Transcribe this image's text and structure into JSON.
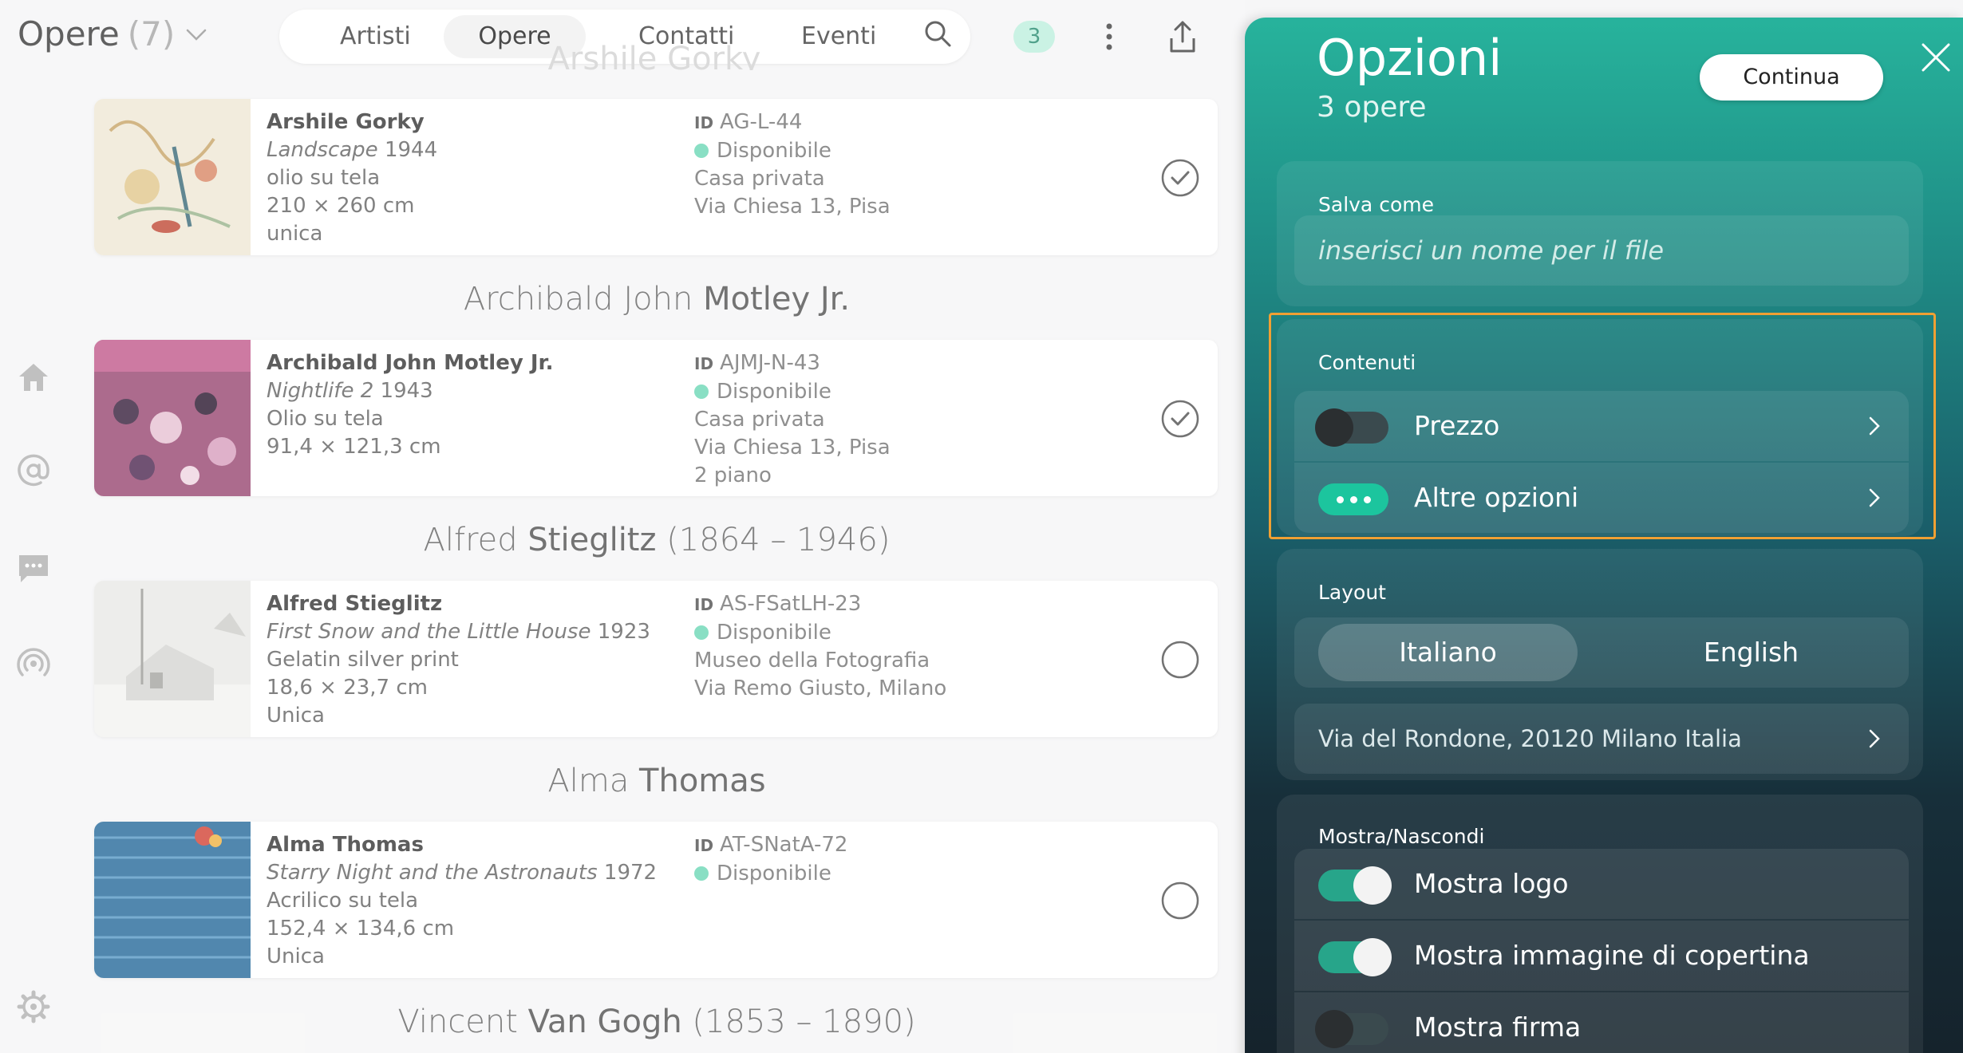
{
  "header": {
    "title": "Opere",
    "count": "(7)",
    "tabs": [
      "Artisti",
      "Opere",
      "Contatti",
      "Eventi"
    ],
    "active_tab": "Opere",
    "selected_badge": "3"
  },
  "ghost_heading": "Arshile Gorky",
  "artworks": [
    {
      "heading_pre": "",
      "heading_bold": "",
      "heading_post": "",
      "artist": "Arshile Gorky",
      "title": "Landscape",
      "year": "1944",
      "medium": "olio su tela",
      "size": "210 × 260 cm",
      "edition": "unica",
      "id": "AG-L-44",
      "status": "Disponibile",
      "location": "Casa privata",
      "address": "Via Chiesa 13, Pisa",
      "extra": "",
      "selected": true
    },
    {
      "heading_pre": "Archibald John ",
      "heading_bold": "Motley Jr.",
      "heading_post": "",
      "artist": "Archibald John Motley Jr.",
      "title": "Nightlife 2",
      "year": "1943",
      "medium": "Olio su tela",
      "size": "91,4 × 121,3 cm",
      "edition": "",
      "id": "AJMJ-N-43",
      "status": "Disponibile",
      "location": "Casa privata",
      "address": "Via Chiesa 13, Pisa",
      "extra": "2 piano",
      "selected": true
    },
    {
      "heading_pre": "Alfred ",
      "heading_bold": "Stieglitz",
      "heading_post": " (1864 – 1946)",
      "artist": "Alfred Stieglitz",
      "title": "First Snow and the Little House",
      "year": "1923",
      "medium": "Gelatin silver print",
      "size": "18,6 × 23,7 cm",
      "edition": "Unica",
      "id": "AS-FSatLH-23",
      "status": "Disponibile",
      "location": "Museo della Fotografia",
      "address": "Via Remo Giusto, Milano",
      "extra": "",
      "selected": false
    },
    {
      "heading_pre": "Alma ",
      "heading_bold": "Thomas",
      "heading_post": "",
      "artist": "Alma Thomas",
      "title": "Starry Night and the Astronauts",
      "year": "1972",
      "medium": "Acrilico su tela",
      "size": "152,4 × 134,6 cm",
      "edition": "Unica",
      "id": "AT-SNatA-72",
      "status": "Disponibile",
      "location": "",
      "address": "",
      "extra": "",
      "selected": false
    }
  ],
  "next_heading": {
    "pre": "Vincent ",
    "bold": "Van Gogh",
    "post": " (1853 – 1890)"
  },
  "id_label": "ID",
  "panel": {
    "title": "Opzioni",
    "subtitle": "3 opere",
    "continue_label": "Continua",
    "save_as": {
      "label": "Salva come",
      "placeholder": "inserisci un nome per il file",
      "value": ""
    },
    "contents": {
      "label": "Contenuti",
      "price_label": "Prezzo",
      "price_on": false,
      "more_label": "Altre opzioni"
    },
    "layout": {
      "label": "Layout",
      "languages": [
        "Italiano",
        "English"
      ],
      "selected_language": "Italiano",
      "address": "Via del Rondone, 20120 Milano Italia"
    },
    "show_hide": {
      "label": "Mostra/Nascondi",
      "items": [
        {
          "label": "Mostra logo",
          "on": true
        },
        {
          "label": "Mostra immagine di copertina",
          "on": true
        },
        {
          "label": "Mostra firma",
          "on": false
        }
      ]
    }
  },
  "colors": {
    "accent": "#1cc59e",
    "highlight": "#f0a033",
    "status_dot": "#6fd8b8"
  }
}
